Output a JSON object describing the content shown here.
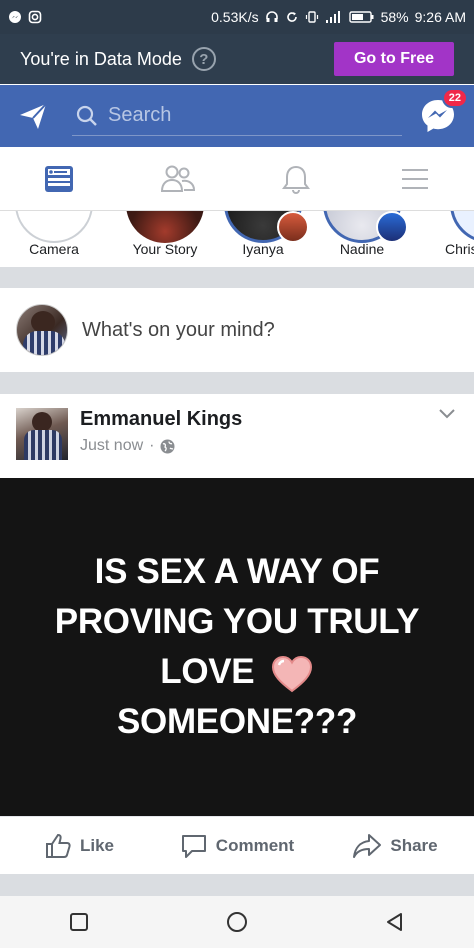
{
  "status_bar": {
    "net_speed": "0.53K/s",
    "battery": "58%",
    "time": "9:26 AM"
  },
  "data_banner": {
    "text": "You're in Data Mode",
    "help": "?",
    "button": "Go to Free",
    "button_color": "#a234c7"
  },
  "header": {
    "search_placeholder": "Search",
    "messenger_badge": "22",
    "brand_color": "#4267b2"
  },
  "tabs": [
    {
      "name": "news-feed",
      "icon": "feed-icon",
      "active": true
    },
    {
      "name": "friends",
      "icon": "friends-icon"
    },
    {
      "name": "notifications",
      "icon": "bell-icon"
    },
    {
      "name": "menu",
      "icon": "menu-icon"
    }
  ],
  "stories": [
    {
      "label": "Camera"
    },
    {
      "label": "Your Story"
    },
    {
      "label": "Iyanya"
    },
    {
      "label": "Nadine"
    },
    {
      "label": "Chris"
    }
  ],
  "composer": {
    "prompt": "What's on your mind?"
  },
  "post": {
    "author": "Emmanuel Kings",
    "time": "Just now",
    "separator": "·",
    "image_text_lines": [
      "IS SEX A WAY OF",
      "PROVING YOU TRULY",
      "LOVE",
      "SOMEONE???"
    ]
  },
  "actions": {
    "like": "Like",
    "comment": "Comment",
    "share": "Share"
  }
}
